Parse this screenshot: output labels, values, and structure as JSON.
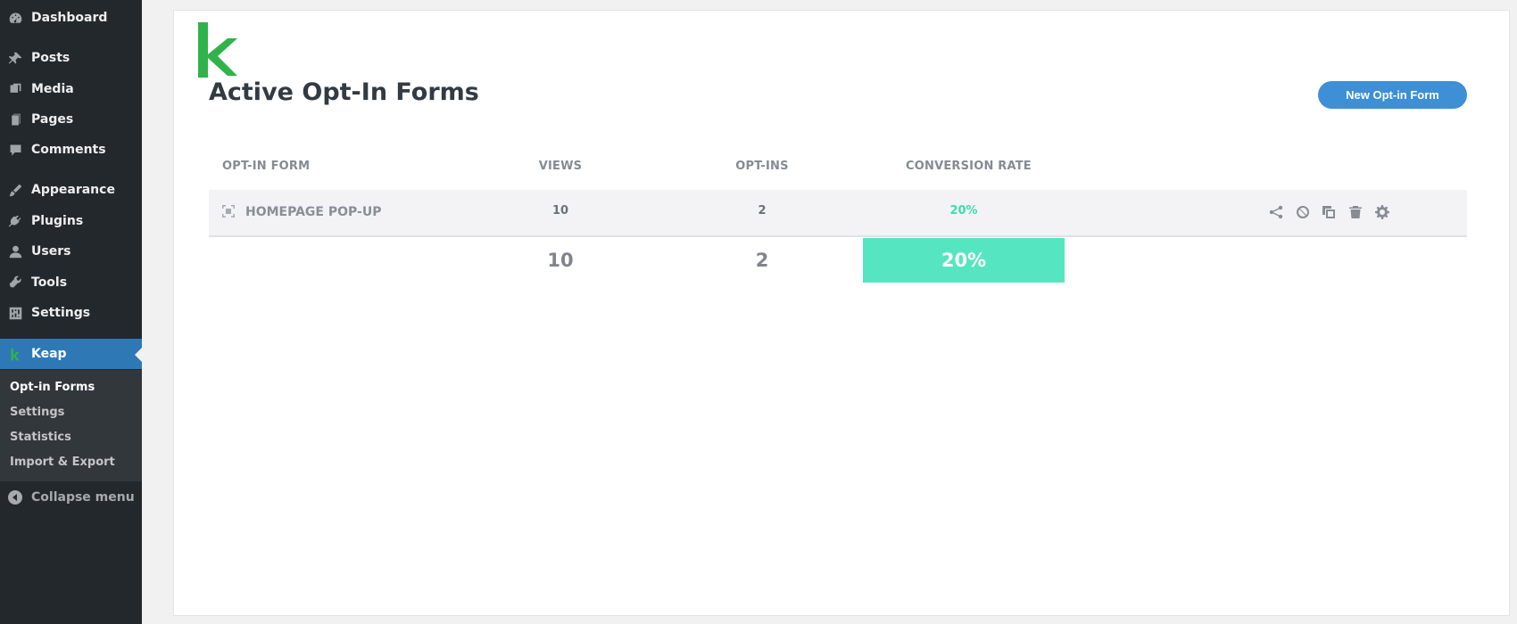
{
  "sidebar": {
    "items": [
      {
        "label": "Dashboard",
        "icon": "dashboard-icon"
      },
      {
        "label": "Posts",
        "icon": "pin-icon"
      },
      {
        "label": "Media",
        "icon": "media-icon"
      },
      {
        "label": "Pages",
        "icon": "pages-icon"
      },
      {
        "label": "Comments",
        "icon": "comment-icon"
      },
      {
        "label": "Appearance",
        "icon": "brush-icon"
      },
      {
        "label": "Plugins",
        "icon": "plug-icon"
      },
      {
        "label": "Users",
        "icon": "user-icon"
      },
      {
        "label": "Tools",
        "icon": "wrench-icon"
      },
      {
        "label": "Settings",
        "icon": "sliders-icon"
      },
      {
        "label": "Keap",
        "icon": "keap-logo-icon"
      }
    ],
    "submenu": [
      {
        "label": "Opt-in Forms"
      },
      {
        "label": "Settings"
      },
      {
        "label": "Statistics"
      },
      {
        "label": "Import & Export"
      }
    ],
    "collapse_label": "Collapse menu"
  },
  "main": {
    "title": "Active Opt-In Forms",
    "new_button": "New Opt-in Form",
    "columns": [
      "OPT-IN FORM",
      "VIEWS",
      "OPT-INS",
      "CONVERSION RATE"
    ],
    "rows": [
      {
        "name": "HOMEPAGE POP-UP",
        "views": "10",
        "optins": "2",
        "rate": "20%"
      }
    ],
    "totals": {
      "views": "10",
      "optins": "2",
      "rate": "20%"
    }
  },
  "colors": {
    "sidebar_bg": "#23282d",
    "active_menu": "#2f78b6",
    "brand_green": "#2fb34a",
    "button_blue": "#3d8fd6",
    "rate_green": "#55e6c1"
  }
}
